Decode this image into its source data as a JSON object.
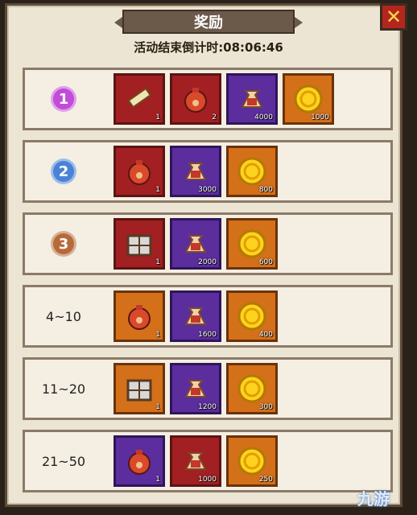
{
  "header": {
    "title": "奖励",
    "countdown": "活动结束倒计时:08:06:46"
  },
  "close_button": {
    "icon": "close-x-icon"
  },
  "rows": [
    {
      "rank_label": "1",
      "rank_type": "gold-medal",
      "items": [
        {
          "icon": "scroll-icon",
          "qty": "1",
          "color": "red"
        },
        {
          "icon": "paw-bag-icon",
          "qty": "2",
          "color": "red"
        },
        {
          "icon": "bone-sack-icon",
          "qty": "4000",
          "color": "purple"
        },
        {
          "icon": "gold-coin-icon",
          "qty": "1000",
          "color": "orange"
        }
      ]
    },
    {
      "rank_label": "2",
      "rank_type": "silver-medal",
      "items": [
        {
          "icon": "paw-bag-icon",
          "qty": "1",
          "color": "red"
        },
        {
          "icon": "bone-sack-icon",
          "qty": "3000",
          "color": "purple"
        },
        {
          "icon": "gold-coin-icon",
          "qty": "800",
          "color": "orange"
        }
      ]
    },
    {
      "rank_label": "3",
      "rank_type": "bronze-medal",
      "items": [
        {
          "icon": "crate-icon",
          "qty": "1",
          "color": "red"
        },
        {
          "icon": "bone-sack-icon",
          "qty": "2000",
          "color": "purple"
        },
        {
          "icon": "gold-coin-icon",
          "qty": "600",
          "color": "orange"
        }
      ]
    },
    {
      "rank_label": "4~10",
      "rank_type": "text",
      "items": [
        {
          "icon": "paw-bag-icon",
          "qty": "1",
          "color": "orange"
        },
        {
          "icon": "bone-sack-icon",
          "qty": "1600",
          "color": "purple"
        },
        {
          "icon": "gold-coin-icon",
          "qty": "400",
          "color": "orange"
        }
      ]
    },
    {
      "rank_label": "11~20",
      "rank_type": "text",
      "items": [
        {
          "icon": "crate-icon",
          "qty": "1",
          "color": "orange"
        },
        {
          "icon": "bone-sack-icon",
          "qty": "1200",
          "color": "purple"
        },
        {
          "icon": "gold-coin-icon",
          "qty": "300",
          "color": "orange"
        }
      ]
    },
    {
      "rank_label": "21~50",
      "rank_type": "text",
      "items": [
        {
          "icon": "paw-bag-icon",
          "qty": "1",
          "color": "purple"
        },
        {
          "icon": "bone-sack-icon",
          "qty": "1000",
          "color": "red"
        },
        {
          "icon": "gold-coin-icon",
          "qty": "250",
          "color": "orange"
        }
      ]
    }
  ],
  "watermark": "九游"
}
